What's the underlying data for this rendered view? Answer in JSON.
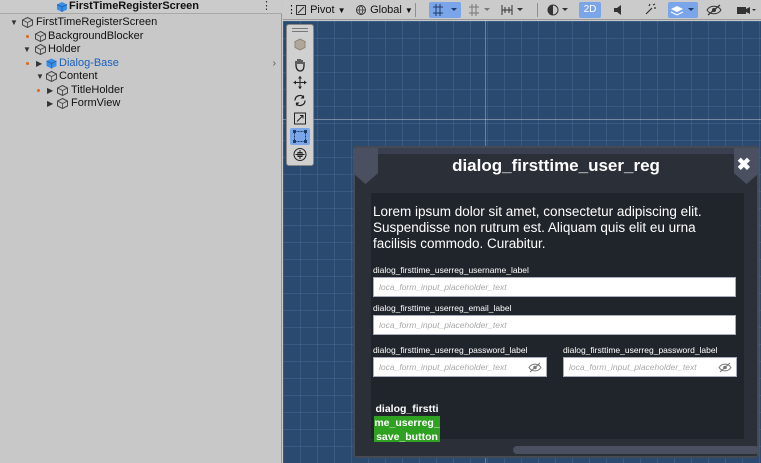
{
  "hierarchy": {
    "title": "FirstTimeRegisterScreen",
    "items": [
      {
        "label": "FirstTimeRegisterScreen"
      },
      {
        "label": "BackgroundBlocker"
      },
      {
        "label": "Holder"
      },
      {
        "label": "Dialog-Base"
      },
      {
        "label": "Content"
      },
      {
        "label": "TitleHolder"
      },
      {
        "label": "FormView"
      }
    ]
  },
  "toolbar": {
    "pivot_label": "Pivot",
    "global_label": "Global",
    "mode_2d_label": "2D"
  },
  "colors": {
    "accent": "#7aa5e8",
    "selected_text": "#1a5fc0",
    "scene_bg": "#2b4a70",
    "dialog_bg": "#20252c",
    "save_button": "#2ea120"
  },
  "dialog": {
    "title": "dialog_firsttime_user_reg",
    "close_icon": "✖",
    "description": "Lorem ipsum dolor sit amet, consectetur adipiscing elit. Suspendisse non rutrum est. Aliquam quis elit eu urna facilisis commodo. Curabitur.",
    "username_label": "dialog_firsttime_userreg_username_label",
    "username_placeholder": "loca_form_input_placeholder_text",
    "email_label": "dialog_firsttime_userreg_email_label",
    "email_placeholder": "loca_form_input_placeholder_text",
    "password_label": "dialog_firsttime_userreg_password_label",
    "password_placeholder": "loca_form_input_placeholder_text",
    "password_confirm_label": "dialog_firsttime_userreg_password_label",
    "password_confirm_placeholder": "loca_form_input_placeholder_text",
    "save_label": "dialog_firsttime_userreg_save_button"
  }
}
